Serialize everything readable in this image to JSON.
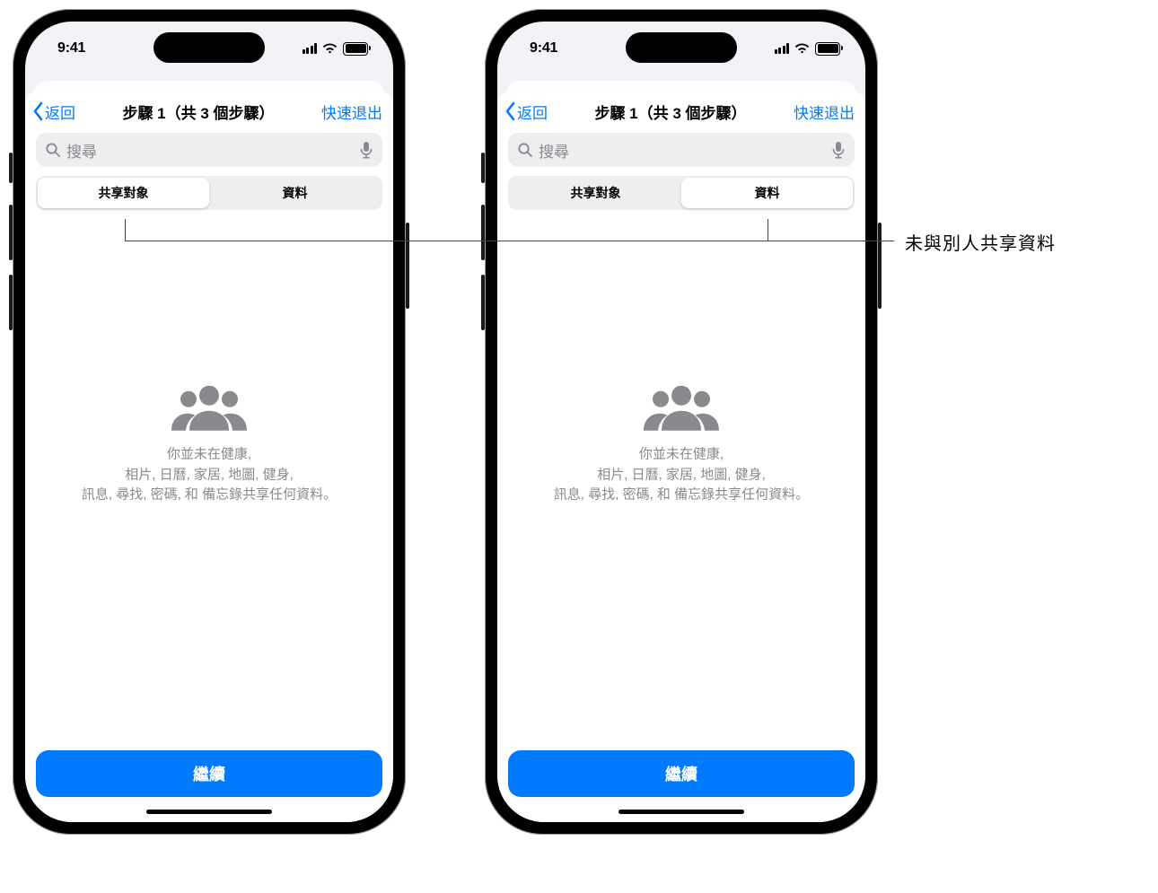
{
  "status": {
    "time": "9:41"
  },
  "nav": {
    "back_label": "返回",
    "title": "步驟 1（共 3 個步驟）",
    "exit_label": "快速退出"
  },
  "search": {
    "placeholder": "搜尋"
  },
  "segmented": {
    "tab_people": "共享對象",
    "tab_info": "資料"
  },
  "empty_state": {
    "line1": "你並未在健康,",
    "line2": "相片, 日曆, 家居, 地圖, 健身,",
    "line3": "訊息, 尋找, 密碼, 和 備忘錄共享任何資料。"
  },
  "continue_label": "繼續",
  "callout": {
    "text": "未與別人共享資料"
  }
}
